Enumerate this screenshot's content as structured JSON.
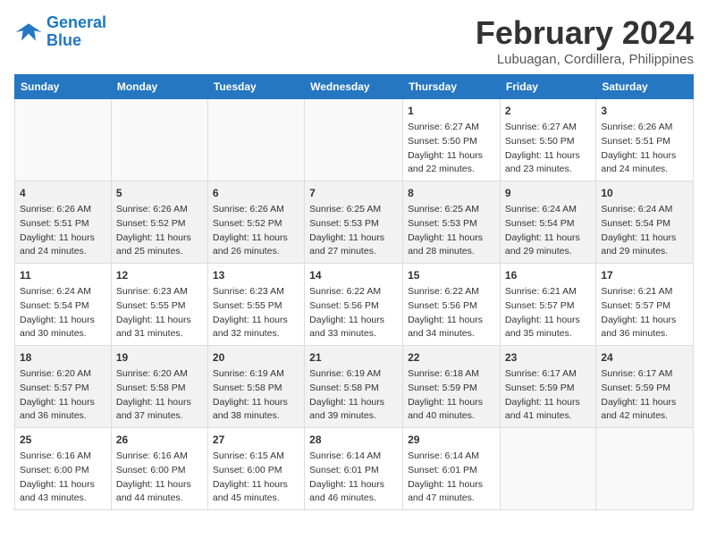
{
  "header": {
    "logo_line1": "General",
    "logo_line2": "Blue",
    "month": "February 2024",
    "location": "Lubuagan, Cordillera, Philippines"
  },
  "columns": [
    "Sunday",
    "Monday",
    "Tuesday",
    "Wednesday",
    "Thursday",
    "Friday",
    "Saturday"
  ],
  "weeks": [
    [
      {
        "day": "",
        "data": ""
      },
      {
        "day": "",
        "data": ""
      },
      {
        "day": "",
        "data": ""
      },
      {
        "day": "",
        "data": ""
      },
      {
        "day": "1",
        "data": "Sunrise: 6:27 AM\nSunset: 5:50 PM\nDaylight: 11 hours and 22 minutes."
      },
      {
        "day": "2",
        "data": "Sunrise: 6:27 AM\nSunset: 5:50 PM\nDaylight: 11 hours and 23 minutes."
      },
      {
        "day": "3",
        "data": "Sunrise: 6:26 AM\nSunset: 5:51 PM\nDaylight: 11 hours and 24 minutes."
      }
    ],
    [
      {
        "day": "4",
        "data": "Sunrise: 6:26 AM\nSunset: 5:51 PM\nDaylight: 11 hours and 24 minutes."
      },
      {
        "day": "5",
        "data": "Sunrise: 6:26 AM\nSunset: 5:52 PM\nDaylight: 11 hours and 25 minutes."
      },
      {
        "day": "6",
        "data": "Sunrise: 6:26 AM\nSunset: 5:52 PM\nDaylight: 11 hours and 26 minutes."
      },
      {
        "day": "7",
        "data": "Sunrise: 6:25 AM\nSunset: 5:53 PM\nDaylight: 11 hours and 27 minutes."
      },
      {
        "day": "8",
        "data": "Sunrise: 6:25 AM\nSunset: 5:53 PM\nDaylight: 11 hours and 28 minutes."
      },
      {
        "day": "9",
        "data": "Sunrise: 6:24 AM\nSunset: 5:54 PM\nDaylight: 11 hours and 29 minutes."
      },
      {
        "day": "10",
        "data": "Sunrise: 6:24 AM\nSunset: 5:54 PM\nDaylight: 11 hours and 29 minutes."
      }
    ],
    [
      {
        "day": "11",
        "data": "Sunrise: 6:24 AM\nSunset: 5:54 PM\nDaylight: 11 hours and 30 minutes."
      },
      {
        "day": "12",
        "data": "Sunrise: 6:23 AM\nSunset: 5:55 PM\nDaylight: 11 hours and 31 minutes."
      },
      {
        "day": "13",
        "data": "Sunrise: 6:23 AM\nSunset: 5:55 PM\nDaylight: 11 hours and 32 minutes."
      },
      {
        "day": "14",
        "data": "Sunrise: 6:22 AM\nSunset: 5:56 PM\nDaylight: 11 hours and 33 minutes."
      },
      {
        "day": "15",
        "data": "Sunrise: 6:22 AM\nSunset: 5:56 PM\nDaylight: 11 hours and 34 minutes."
      },
      {
        "day": "16",
        "data": "Sunrise: 6:21 AM\nSunset: 5:57 PM\nDaylight: 11 hours and 35 minutes."
      },
      {
        "day": "17",
        "data": "Sunrise: 6:21 AM\nSunset: 5:57 PM\nDaylight: 11 hours and 36 minutes."
      }
    ],
    [
      {
        "day": "18",
        "data": "Sunrise: 6:20 AM\nSunset: 5:57 PM\nDaylight: 11 hours and 36 minutes."
      },
      {
        "day": "19",
        "data": "Sunrise: 6:20 AM\nSunset: 5:58 PM\nDaylight: 11 hours and 37 minutes."
      },
      {
        "day": "20",
        "data": "Sunrise: 6:19 AM\nSunset: 5:58 PM\nDaylight: 11 hours and 38 minutes."
      },
      {
        "day": "21",
        "data": "Sunrise: 6:19 AM\nSunset: 5:58 PM\nDaylight: 11 hours and 39 minutes."
      },
      {
        "day": "22",
        "data": "Sunrise: 6:18 AM\nSunset: 5:59 PM\nDaylight: 11 hours and 40 minutes."
      },
      {
        "day": "23",
        "data": "Sunrise: 6:17 AM\nSunset: 5:59 PM\nDaylight: 11 hours and 41 minutes."
      },
      {
        "day": "24",
        "data": "Sunrise: 6:17 AM\nSunset: 5:59 PM\nDaylight: 11 hours and 42 minutes."
      }
    ],
    [
      {
        "day": "25",
        "data": "Sunrise: 6:16 AM\nSunset: 6:00 PM\nDaylight: 11 hours and 43 minutes."
      },
      {
        "day": "26",
        "data": "Sunrise: 6:16 AM\nSunset: 6:00 PM\nDaylight: 11 hours and 44 minutes."
      },
      {
        "day": "27",
        "data": "Sunrise: 6:15 AM\nSunset: 6:00 PM\nDaylight: 11 hours and 45 minutes."
      },
      {
        "day": "28",
        "data": "Sunrise: 6:14 AM\nSunset: 6:01 PM\nDaylight: 11 hours and 46 minutes."
      },
      {
        "day": "29",
        "data": "Sunrise: 6:14 AM\nSunset: 6:01 PM\nDaylight: 11 hours and 47 minutes."
      },
      {
        "day": "",
        "data": ""
      },
      {
        "day": "",
        "data": ""
      }
    ]
  ]
}
